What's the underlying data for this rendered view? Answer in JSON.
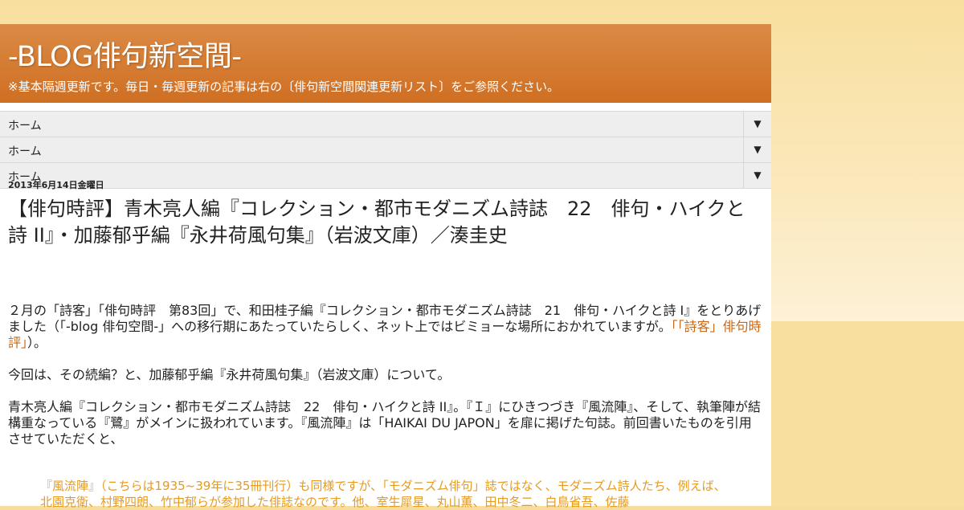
{
  "blog": {
    "title": "-BLOG俳句新空間-",
    "description": "※基本隔週更新です。毎日・毎週更新の記事は右の〔俳句新空間関連更新リスト〕をご参照ください。"
  },
  "nav": [
    {
      "label": "ホーム",
      "arrow": "▼"
    },
    {
      "label": "ホーム",
      "arrow": "▼"
    },
    {
      "label": "ホーム",
      "arrow": "▼"
    }
  ],
  "post": {
    "date": "2013年6月14日金曜日",
    "title": "【俳句時評】青木亮人編『コレクション・都市モダニズム詩誌　22　俳句・ハイクと詩 II』・加藤郁乎編『永井荷風句集』（岩波文庫）／湊圭史",
    "p1_text": "２月の「詩客」「俳句時評　第83回」で、和田桂子編『コレクション・都市モダニズム詩誌　21　俳句・ハイクと詩 I』をとりあげました（「-blog 俳句空間-」への移行期にあたっていたらしく、ネット上ではビミョーな場所におかれていますが。",
    "p1_link": "「「詩客」俳句時評」",
    "p1_end": "）。",
    "p2": "今回は、その続編？と、加藤郁乎編『永井荷風句集』（岩波文庫）について。",
    "p3": "青木亮人編『コレクション・都市モダニズム詩誌　22　俳句・ハイクと詩 II』。『Ｉ』にひきつづき『風流陣』、そして、執筆陣が結構重なっている『鷺』がメインに扱われています。『風流陣』は「HAIKAI DU JAPON」を扉に掲げた句誌。前回書いたものを引用させていただくと、",
    "quote": "『風流陣』（こちらは1935~39年に35冊刊行）も同様ですが、「モダニズム俳句」誌ではなく、モダニズム詩人たち、例えば、北園克衛、村野四朗、竹中郁らが参加した俳誌なのです。他、室生犀星、丸山薫、田中冬二、白鳥省吾、佐藤"
  },
  "colors": {
    "header": "#cf6f22",
    "link": "#cc6611",
    "quote": "#e69a1f",
    "background": "#f6dd9e"
  }
}
